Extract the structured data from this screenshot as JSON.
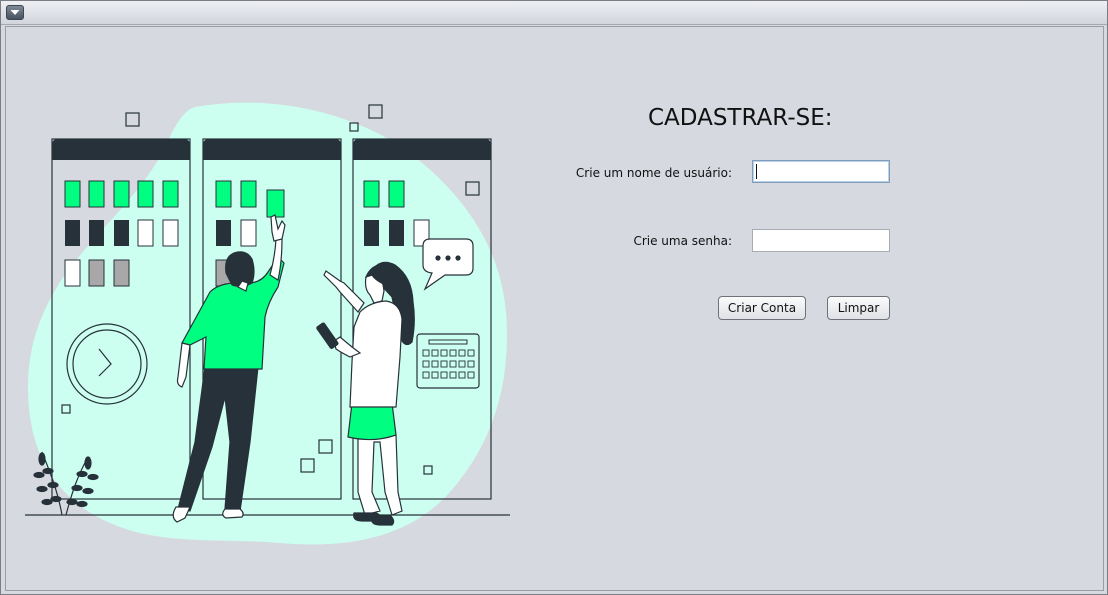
{
  "window": {
    "menu_icon": "chevron-down-icon"
  },
  "form": {
    "title": "CADASTRAR-SE:",
    "username_label": "Crie um nome de usuário:",
    "username_value": "",
    "password_label": "Crie uma senha:",
    "password_value": "",
    "create_button_label": "Criar Conta",
    "clear_button_label": "Limpar"
  },
  "colors": {
    "accent_green": "#00ff80",
    "blob_mint": "#ccfff0",
    "panel_dark": "#27313a",
    "background": "#d6d9e0"
  },
  "illustration": {
    "description_icon": "team-planning-board-illustration"
  }
}
